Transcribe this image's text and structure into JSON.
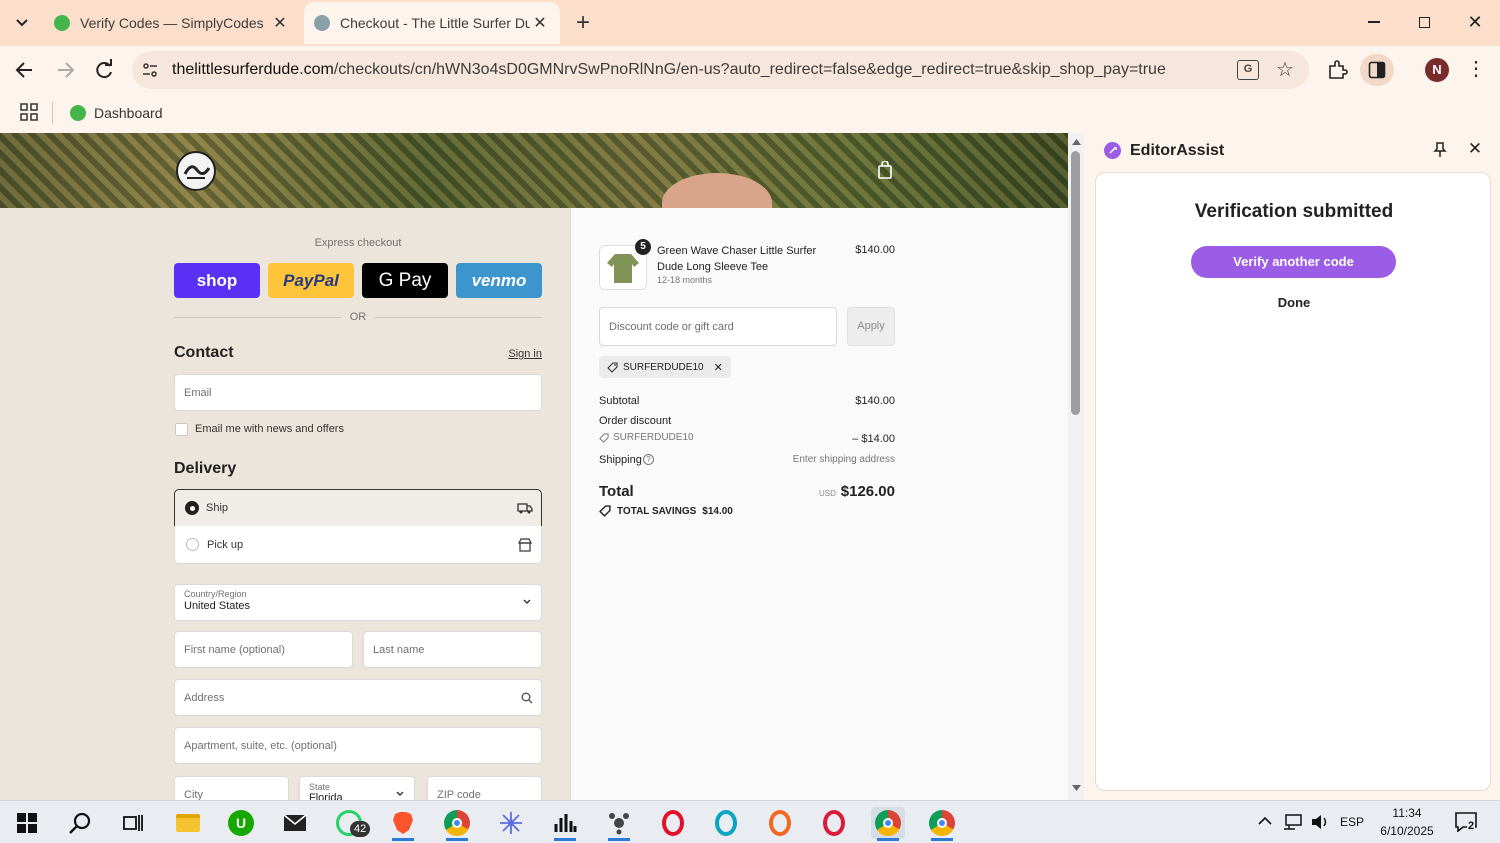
{
  "browser": {
    "tabs": [
      {
        "title": "Verify Codes — SimplyCodes",
        "active": false
      },
      {
        "title": "Checkout - The Little Surfer Dude",
        "active": true
      }
    ],
    "url_domain": "thelittlesurferdude.com",
    "url_path": "/checkouts/cn/hWN3o4sD0GMNrvSwPnoRlNnG/en-us?auto_redirect=false&edge_redirect=true&skip_shop_pay=true",
    "profile_initial": "N",
    "bookmark": "Dashboard"
  },
  "checkout": {
    "express_label": "Express checkout",
    "pay_buttons": {
      "shop": "shop",
      "paypal": "PayPal",
      "gpay": "G Pay",
      "venmo": "venmo"
    },
    "or_label": "OR",
    "contact_heading": "Contact",
    "sign_in": "Sign in",
    "email_placeholder": "Email",
    "news_label": "Email me with news and offers",
    "delivery_heading": "Delivery",
    "ship_label": "Ship",
    "pickup_label": "Pick up",
    "country_label": "Country/Region",
    "country_value": "United States",
    "first_name": "First name (optional)",
    "last_name": "Last name",
    "address": "Address",
    "apartment": "Apartment, suite, etc. (optional)",
    "city": "City",
    "state_label": "State",
    "state_value": "Florida",
    "zip": "ZIP code"
  },
  "summary": {
    "product_name": "Green Wave Chaser Little Surfer Dude Long Sleeve Tee",
    "product_variant": "12-18 months",
    "product_qty": "5",
    "product_price": "$140.00",
    "discount_placeholder": "Discount code or gift card",
    "apply": "Apply",
    "code_tag": "SURFERDUDE10",
    "subtotal_label": "Subtotal",
    "subtotal_value": "$140.00",
    "order_discount_label": "Order discount",
    "discount_code": "SURFERDUDE10",
    "discount_value": "– $14.00",
    "shipping_label": "Shipping",
    "shipping_value": "Enter shipping address",
    "total_label": "Total",
    "currency": "USD",
    "total_value": "$126.00",
    "savings_label": "TOTAL SAVINGS",
    "savings_value": "$14.00"
  },
  "panel": {
    "title": "EditorAssist",
    "heading": "Verification submitted",
    "verify_button": "Verify another code",
    "done": "Done"
  },
  "taskbar": {
    "whatsapp_badge": "42",
    "language": "ESP",
    "time": "11:34",
    "date": "6/10/2025",
    "notifications": "2"
  },
  "colors": {
    "shop": "#5a31f4",
    "paypal": "#ffc439",
    "venmo": "#3d95ce",
    "panel_accent": "#9b5de5"
  }
}
